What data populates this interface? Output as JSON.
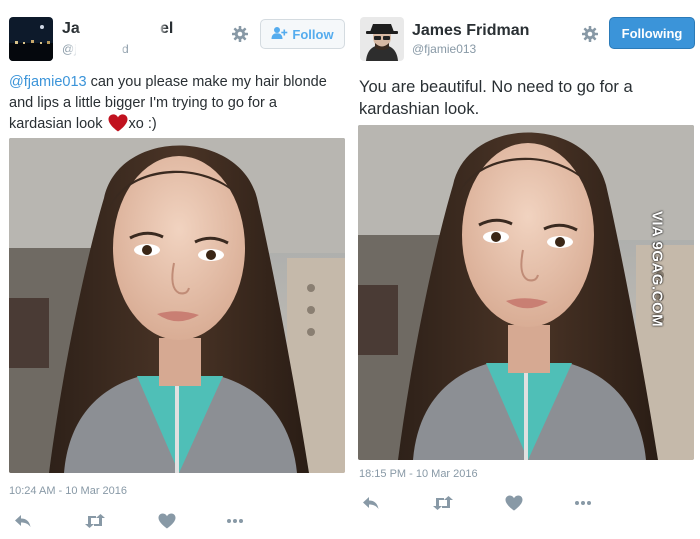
{
  "left_tweet": {
    "user": {
      "name_visible": "Ja el",
      "name_start": "Ja",
      "name_end": "el",
      "handle_start": "@j",
      "handle_end": "d"
    },
    "follow_label": "Follow",
    "icons": {
      "settings": "gear-icon",
      "follow": "add-user-icon",
      "reply": "reply-icon",
      "retweet": "retweet-icon",
      "like": "heart-icon",
      "more": "more-icon"
    },
    "text": {
      "mention": "@fjamie013",
      "line1_rest": " can you please make my hair blonde",
      "line2": "and lips a little bigger I'm trying to go for a",
      "line3_before": "kardasian look ",
      "line3_after": "xo :)"
    },
    "timestamp": "10:24 AM - 10 Mar 2016"
  },
  "right_tweet": {
    "user": {
      "name": "James Fridman",
      "handle": "@fjamie013"
    },
    "following_label": "Following",
    "text": {
      "line1": "You are beautiful. No need to go for a",
      "line2": "kardashian look."
    },
    "timestamp": "18:15 PM - 10 Mar 2016"
  },
  "watermark": "VIA 9GAG.COM",
  "colors": {
    "link": "#3b94d9",
    "follow_text": "#55acee",
    "following_bg": "#3b94d9",
    "muted": "#8899a6",
    "text": "#292f33",
    "heart": "#e0245e"
  }
}
